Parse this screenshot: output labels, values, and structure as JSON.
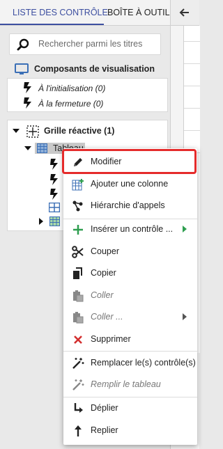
{
  "tabs": [
    {
      "label": "LISTE DES CONTRÔLE"
    },
    {
      "label": "BOÎTE À OUTILS"
    }
  ],
  "search": {
    "placeholder": "Rechercher parmi les titres"
  },
  "sections": {
    "visualization": {
      "title": "Composants de visualisation",
      "events": [
        {
          "label": "À l'initialisation (0)"
        },
        {
          "label": "À la fermeture (0)"
        }
      ]
    }
  },
  "tree": {
    "root_label": "Grille réactive (1)",
    "child_label": "Tableau"
  },
  "menu": {
    "items": [
      {
        "label": "Modifier",
        "icon": "pencil-icon"
      },
      {
        "label": "Ajouter une colonne",
        "icon": "add-column-icon"
      },
      {
        "label": "Hiérarchie d'appels",
        "icon": "hierarchy-icon"
      },
      {
        "label": "Insérer un contrôle ...",
        "icon": "plus-icon"
      },
      {
        "label": "Couper",
        "icon": "scissors-icon"
      },
      {
        "label": "Copier",
        "icon": "copy-icon"
      },
      {
        "label": "Coller",
        "icon": "paste-icon"
      },
      {
        "label": "Coller ...",
        "icon": "paste-icon"
      },
      {
        "label": "Supprimer",
        "icon": "delete-icon"
      },
      {
        "label": "Remplacer le(s) contrôle(s)",
        "icon": "magic-wand-icon"
      },
      {
        "label": "Remplir le tableau",
        "icon": "magic-wand-icon"
      },
      {
        "label": "Déplier",
        "icon": "expand-icon"
      },
      {
        "label": "Replier",
        "icon": "collapse-icon"
      }
    ]
  },
  "colors": {
    "accent": "#3d4fa0",
    "highlight": "#e52b2b",
    "green": "#2e9e4f",
    "red": "#d32f2f"
  }
}
